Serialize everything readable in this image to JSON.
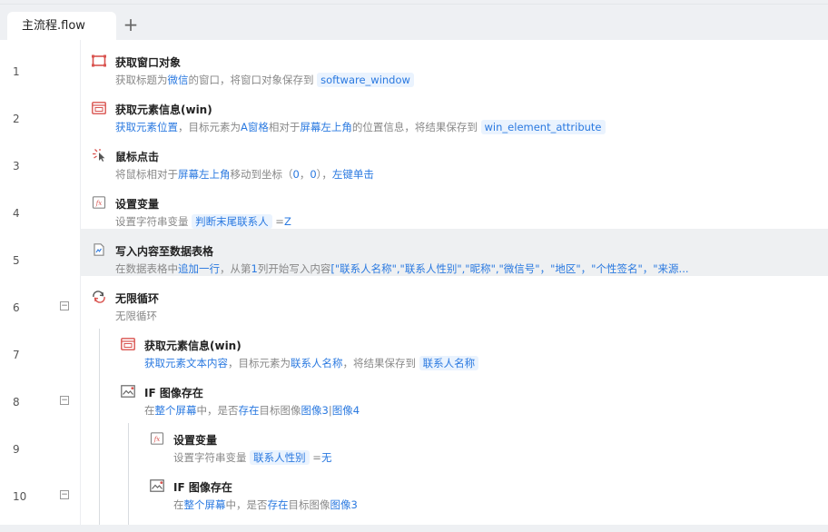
{
  "tabs": [
    {
      "label": "主流程.flow"
    }
  ],
  "add_tab_symbol": "+",
  "collapse_symbol": "−",
  "lines": [
    {
      "num": "1",
      "title": "获取窗口对象",
      "desc": [
        {
          "t": "获取标题为"
        },
        {
          "t": "微信",
          "s": "blue"
        },
        {
          "t": "的窗口，将窗口对象保存到 "
        },
        {
          "t": "software_window",
          "s": "pill"
        }
      ]
    },
    {
      "num": "2",
      "title": "获取元素信息(win)",
      "desc": [
        {
          "t": "获取元素位置",
          "s": "blue"
        },
        {
          "t": "，目标元素为"
        },
        {
          "t": "A窗格",
          "s": "blue"
        },
        {
          "t": "相对于"
        },
        {
          "t": "屏幕左上角",
          "s": "blue"
        },
        {
          "t": "的位置信息，将结果保存到 "
        },
        {
          "t": "win_element_attribute",
          "s": "pill"
        }
      ]
    },
    {
      "num": "3",
      "title": "鼠标点击",
      "desc": [
        {
          "t": "将鼠标相对于"
        },
        {
          "t": "屏幕左上角",
          "s": "blue"
        },
        {
          "t": "移动到坐标（"
        },
        {
          "t": "0",
          "s": "blue"
        },
        {
          "t": "，"
        },
        {
          "t": "0",
          "s": "blue"
        },
        {
          "t": "），"
        },
        {
          "t": "左键单击",
          "s": "blue"
        }
      ]
    },
    {
      "num": "4",
      "title": "设置变量",
      "desc": [
        {
          "t": "设置字符串变量 "
        },
        {
          "t": "判断末尾联系人",
          "s": "pill"
        },
        {
          "t": " ="
        },
        {
          "t": "Z",
          "s": "blue"
        }
      ]
    },
    {
      "num": "5",
      "title": "写入内容至数据表格",
      "selected": true,
      "desc": [
        {
          "t": "在数据表格中"
        },
        {
          "t": "追加一行",
          "s": "blue"
        },
        {
          "t": "，从第"
        },
        {
          "t": "1",
          "s": "blue"
        },
        {
          "t": "列开始写入内容"
        },
        {
          "t": "[\"联系人名称\",\"联系人性别\",\"昵称\",\"微信号\"，\"地区\"，\"个性签名\"，\"来源...",
          "s": "blue"
        }
      ]
    },
    {
      "num": "6",
      "title": "无限循环",
      "fold": true,
      "desc": [
        {
          "t": "无限循环"
        }
      ]
    },
    {
      "num": "7",
      "title": "获取元素信息(win)",
      "desc": [
        {
          "t": "获取元素文本内容",
          "s": "blue"
        },
        {
          "t": "，目标元素为"
        },
        {
          "t": "联系人名称",
          "s": "blue"
        },
        {
          "t": "，将结果保存到 "
        },
        {
          "t": "联系人名称",
          "s": "pill"
        }
      ]
    },
    {
      "num": "8",
      "title": "IF 图像存在",
      "fold": true,
      "desc": [
        {
          "t": "在"
        },
        {
          "t": "整个屏幕",
          "s": "blue"
        },
        {
          "t": "中，是否"
        },
        {
          "t": "存在",
          "s": "blue"
        },
        {
          "t": "目标图像"
        },
        {
          "t": "图像3",
          "s": "blue"
        },
        {
          "t": "|"
        },
        {
          "t": "图像4",
          "s": "blue"
        }
      ]
    },
    {
      "num": "9",
      "title": "设置变量",
      "desc": [
        {
          "t": "设置字符串变量 "
        },
        {
          "t": "联系人性别",
          "s": "pill"
        },
        {
          "t": " ="
        },
        {
          "t": "无",
          "s": "blue"
        }
      ]
    },
    {
      "num": "10",
      "title": "IF 图像存在",
      "fold": true,
      "desc": [
        {
          "t": "在"
        },
        {
          "t": "整个屏幕",
          "s": "blue"
        },
        {
          "t": "中，是否"
        },
        {
          "t": "存在",
          "s": "blue"
        },
        {
          "t": "目标图像"
        },
        {
          "t": "图像3",
          "s": "blue"
        }
      ]
    }
  ],
  "colors": {
    "accent": "#2a79e0",
    "pill_bg": "#eaf3fe",
    "icon_red": "#d9534f"
  }
}
